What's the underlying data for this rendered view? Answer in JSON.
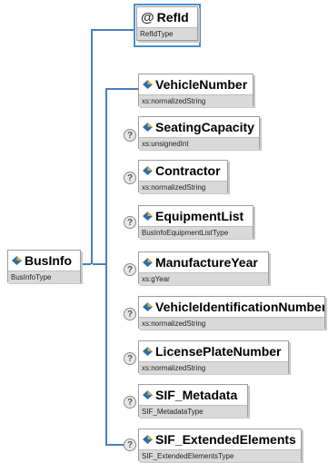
{
  "root": {
    "name": "BusInfo",
    "type": "BusInfoType"
  },
  "attribute": {
    "symbol": "@",
    "name": "RefId",
    "type": "RefIdType"
  },
  "elements": [
    {
      "name": "VehicleNumber",
      "type": "xs:normalizedString",
      "optional": false
    },
    {
      "name": "SeatingCapacity",
      "type": "xs:unsignedInt",
      "optional": true
    },
    {
      "name": "Contractor",
      "type": "xs:normalizedString",
      "optional": true
    },
    {
      "name": "EquipmentList",
      "type": "BusInfoEquipmentListType",
      "optional": true
    },
    {
      "name": "ManufactureYear",
      "type": "xs:gYear",
      "optional": true
    },
    {
      "name": "VehicleIdentificationNumber",
      "type": "xs:normalizedString",
      "optional": true
    },
    {
      "name": "LicensePlateNumber",
      "type": "xs:normalizedString",
      "optional": true
    },
    {
      "name": "SIF_Metadata",
      "type": "SIF_MetadataType",
      "optional": true
    },
    {
      "name": "SIF_ExtendedElements",
      "type": "SIF_ExtendedElementsType",
      "optional": true
    }
  ],
  "optional_symbol": "?",
  "colors": {
    "connector": "#4a7fc0",
    "attribute_border": "#4a8ccc",
    "type_bar": "#d9d9d9"
  },
  "icons": {
    "element": "element-diamond-icon",
    "optional": "optional-question-icon"
  }
}
